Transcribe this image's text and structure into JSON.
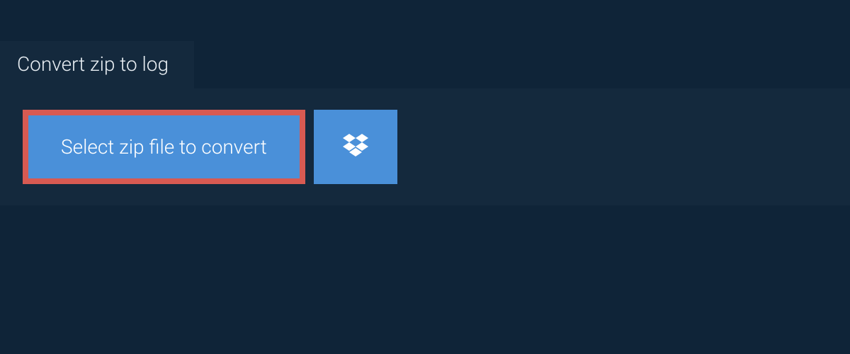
{
  "tab": {
    "label": "Convert zip to log"
  },
  "actions": {
    "select_label": "Select zip file to convert"
  },
  "colors": {
    "bg": "#0f2438",
    "panel": "#14293d",
    "button": "#4a90d9",
    "highlight_border": "#d85a52",
    "text": "#ffffff"
  }
}
